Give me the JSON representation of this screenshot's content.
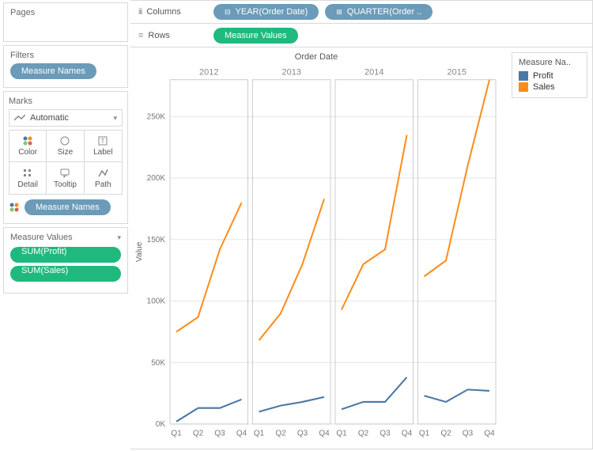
{
  "sidebar": {
    "pages_title": "Pages",
    "filters_title": "Filters",
    "marks_title": "Marks",
    "marks_dropdown": "Automatic",
    "marks_cells": {
      "color": "Color",
      "size": "Size",
      "label": "Label",
      "detail": "Detail",
      "tooltip": "Tooltip",
      "path": "Path"
    },
    "filter_pill": "Measure Names",
    "marks_color_pill": "Measure Names",
    "measure_values_title": "Measure Values",
    "measure_values": [
      "SUM(Profit)",
      "SUM(Sales)"
    ]
  },
  "shelves": {
    "columns_label": "Columns",
    "rows_label": "Rows",
    "columns": [
      "YEAR(Order Date)",
      "QUARTER(Order .."
    ],
    "rows": [
      "Measure Values"
    ]
  },
  "legend": {
    "title": "Measure Na..",
    "items": [
      {
        "label": "Profit",
        "color": "#4a78a6"
      },
      {
        "label": "Sales",
        "color": "#ff8c1a"
      }
    ]
  },
  "chart_title": "Order Date",
  "chart_data": {
    "type": "line",
    "title": "Order Date",
    "xlabel": "",
    "ylabel": "Value",
    "ylim": [
      0,
      280000
    ],
    "yticks": [
      0,
      50000,
      100000,
      150000,
      200000,
      250000
    ],
    "ytick_labels": [
      "0K",
      "50K",
      "100K",
      "150K",
      "200K",
      "250K"
    ],
    "panels": [
      "2012",
      "2013",
      "2014",
      "2015"
    ],
    "categories": [
      "Q1",
      "Q2",
      "Q3",
      "Q4"
    ],
    "series": [
      {
        "name": "Sales",
        "color": "#ff8c1a",
        "values_by_panel": {
          "2012": [
            75000,
            87000,
            142000,
            180000
          ],
          "2013": [
            68000,
            90000,
            130000,
            183000
          ],
          "2014": [
            93000,
            130000,
            142000,
            235000
          ],
          "2015": [
            120000,
            133000,
            210000,
            280000
          ]
        }
      },
      {
        "name": "Profit",
        "color": "#4a78a6",
        "values_by_panel": {
          "2012": [
            2000,
            13000,
            13000,
            20000
          ],
          "2013": [
            10000,
            15000,
            18000,
            22000
          ],
          "2014": [
            12000,
            18000,
            18000,
            38000
          ],
          "2015": [
            23000,
            18000,
            28000,
            27000
          ]
        }
      }
    ]
  }
}
